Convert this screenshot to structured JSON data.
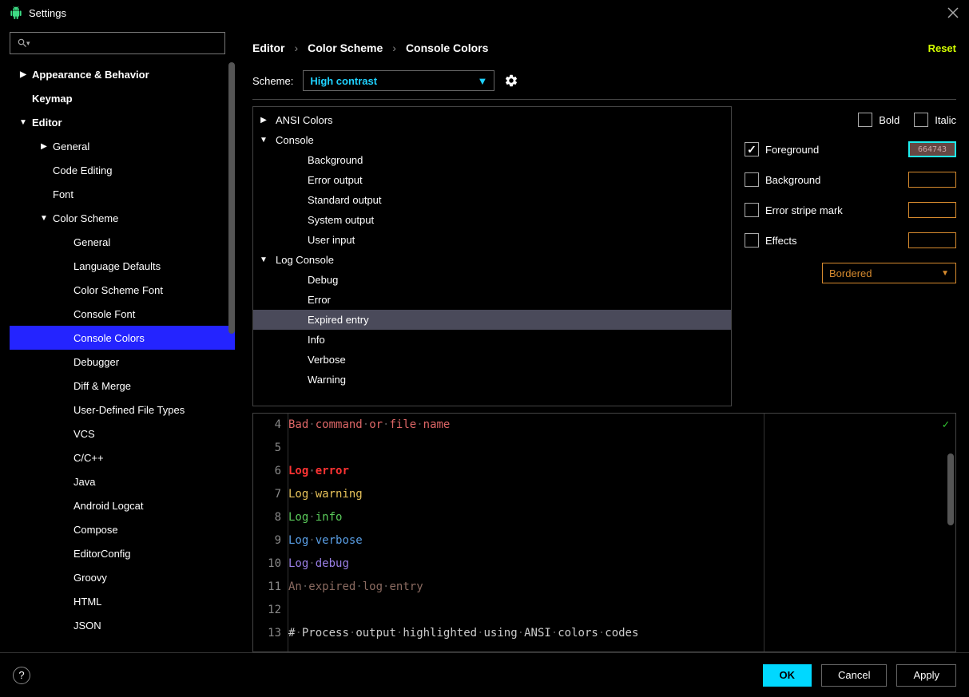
{
  "window": {
    "title": "Settings"
  },
  "breadcrumb": [
    "Editor",
    "Color Scheme",
    "Console Colors"
  ],
  "reset_label": "Reset",
  "scheme": {
    "label": "Scheme:",
    "value": "High contrast"
  },
  "sidebar": {
    "items": [
      {
        "label": "Appearance & Behavior",
        "indent": 0,
        "arrow": "▶",
        "bold": true
      },
      {
        "label": "Keymap",
        "indent": 0,
        "arrow": "",
        "bold": true
      },
      {
        "label": "Editor",
        "indent": 0,
        "arrow": "▼",
        "bold": true
      },
      {
        "label": "General",
        "indent": 1,
        "arrow": "▶",
        "bold": false
      },
      {
        "label": "Code Editing",
        "indent": 1,
        "arrow": "",
        "bold": false
      },
      {
        "label": "Font",
        "indent": 1,
        "arrow": "",
        "bold": false
      },
      {
        "label": "Color Scheme",
        "indent": 1,
        "arrow": "▼",
        "bold": false
      },
      {
        "label": "General",
        "indent": 2,
        "arrow": "",
        "bold": false
      },
      {
        "label": "Language Defaults",
        "indent": 2,
        "arrow": "",
        "bold": false
      },
      {
        "label": "Color Scheme Font",
        "indent": 2,
        "arrow": "",
        "bold": false
      },
      {
        "label": "Console Font",
        "indent": 2,
        "arrow": "",
        "bold": false
      },
      {
        "label": "Console Colors",
        "indent": 2,
        "arrow": "",
        "bold": false,
        "selected": true
      },
      {
        "label": "Debugger",
        "indent": 2,
        "arrow": "",
        "bold": false
      },
      {
        "label": "Diff & Merge",
        "indent": 2,
        "arrow": "",
        "bold": false
      },
      {
        "label": "User-Defined File Types",
        "indent": 2,
        "arrow": "",
        "bold": false
      },
      {
        "label": "VCS",
        "indent": 2,
        "arrow": "",
        "bold": false
      },
      {
        "label": "C/C++",
        "indent": 2,
        "arrow": "",
        "bold": false
      },
      {
        "label": "Java",
        "indent": 2,
        "arrow": "",
        "bold": false
      },
      {
        "label": "Android Logcat",
        "indent": 2,
        "arrow": "",
        "bold": false
      },
      {
        "label": "Compose",
        "indent": 2,
        "arrow": "",
        "bold": false
      },
      {
        "label": "EditorConfig",
        "indent": 2,
        "arrow": "",
        "bold": false
      },
      {
        "label": "Groovy",
        "indent": 2,
        "arrow": "",
        "bold": false
      },
      {
        "label": "HTML",
        "indent": 2,
        "arrow": "",
        "bold": false
      },
      {
        "label": "JSON",
        "indent": 2,
        "arrow": "",
        "bold": false
      }
    ]
  },
  "categories": [
    {
      "label": "ANSI Colors",
      "indent": 0,
      "arrow": "▶"
    },
    {
      "label": "Console",
      "indent": 0,
      "arrow": "▼"
    },
    {
      "label": "Background",
      "indent": 1,
      "arrow": ""
    },
    {
      "label": "Error output",
      "indent": 1,
      "arrow": ""
    },
    {
      "label": "Standard output",
      "indent": 1,
      "arrow": ""
    },
    {
      "label": "System output",
      "indent": 1,
      "arrow": ""
    },
    {
      "label": "User input",
      "indent": 1,
      "arrow": ""
    },
    {
      "label": "Log Console",
      "indent": 0,
      "arrow": "▼"
    },
    {
      "label": "Debug",
      "indent": 1,
      "arrow": ""
    },
    {
      "label": "Error",
      "indent": 1,
      "arrow": ""
    },
    {
      "label": "Expired entry",
      "indent": 1,
      "arrow": "",
      "selected": true
    },
    {
      "label": "Info",
      "indent": 1,
      "arrow": ""
    },
    {
      "label": "Verbose",
      "indent": 1,
      "arrow": ""
    },
    {
      "label": "Warning",
      "indent": 1,
      "arrow": ""
    }
  ],
  "options": {
    "bold_label": "Bold",
    "italic_label": "Italic",
    "foreground_label": "Foreground",
    "foreground_checked": true,
    "foreground_color": "664743",
    "background_label": "Background",
    "error_stripe_label": "Error stripe mark",
    "effects_label": "Effects",
    "effects_value": "Bordered"
  },
  "preview": {
    "lines": [
      {
        "n": "4",
        "segments": [
          [
            "Bad",
            "#d66"
          ],
          [
            "·",
            "#555"
          ],
          [
            "command",
            "#d66"
          ],
          [
            "·",
            "#555"
          ],
          [
            "or",
            "#d66"
          ],
          [
            "·",
            "#555"
          ],
          [
            "file",
            "#d66"
          ],
          [
            "·",
            "#555"
          ],
          [
            "name",
            "#d66"
          ]
        ]
      },
      {
        "n": "5",
        "segments": []
      },
      {
        "n": "6",
        "segments": [
          [
            "Log",
            "#ff3333"
          ],
          [
            "·",
            "#555"
          ],
          [
            "error",
            "#ff3333"
          ]
        ],
        "bold": true
      },
      {
        "n": "7",
        "segments": [
          [
            "Log",
            "#e6c15a"
          ],
          [
            "·",
            "#555"
          ],
          [
            "warning",
            "#e6c15a"
          ]
        ]
      },
      {
        "n": "8",
        "segments": [
          [
            "Log",
            "#5aca5a"
          ],
          [
            "·",
            "#555"
          ],
          [
            "info",
            "#5aca5a"
          ]
        ]
      },
      {
        "n": "9",
        "segments": [
          [
            "Log",
            "#5a9fe6"
          ],
          [
            "·",
            "#555"
          ],
          [
            "verbose",
            "#5a9fe6"
          ]
        ]
      },
      {
        "n": "10",
        "segments": [
          [
            "Log",
            "#9a7fe6"
          ],
          [
            "·",
            "#555"
          ],
          [
            "debug",
            "#9a7fe6"
          ]
        ]
      },
      {
        "n": "11",
        "segments": [
          [
            "An",
            "#8a6a60"
          ],
          [
            "·",
            "#555"
          ],
          [
            "expired",
            "#8a6a60"
          ],
          [
            "·",
            "#555"
          ],
          [
            "log",
            "#8a6a60"
          ],
          [
            "·",
            "#555"
          ],
          [
            "entry",
            "#8a6a60"
          ]
        ]
      },
      {
        "n": "12",
        "segments": []
      },
      {
        "n": "13",
        "segments": [
          [
            "#",
            "#ccc"
          ],
          [
            "·",
            "#555"
          ],
          [
            "Process",
            "#ccc"
          ],
          [
            "·",
            "#555"
          ],
          [
            "output",
            "#ccc"
          ],
          [
            "·",
            "#555"
          ],
          [
            "highlighted",
            "#ccc"
          ],
          [
            "·",
            "#555"
          ],
          [
            "using",
            "#ccc"
          ],
          [
            "·",
            "#555"
          ],
          [
            "ANSI",
            "#ccc"
          ],
          [
            "·",
            "#555"
          ],
          [
            "colors",
            "#ccc"
          ],
          [
            "·",
            "#555"
          ],
          [
            "codes",
            "#ccc"
          ]
        ]
      }
    ]
  },
  "footer": {
    "ok": "OK",
    "cancel": "Cancel",
    "apply": "Apply"
  }
}
